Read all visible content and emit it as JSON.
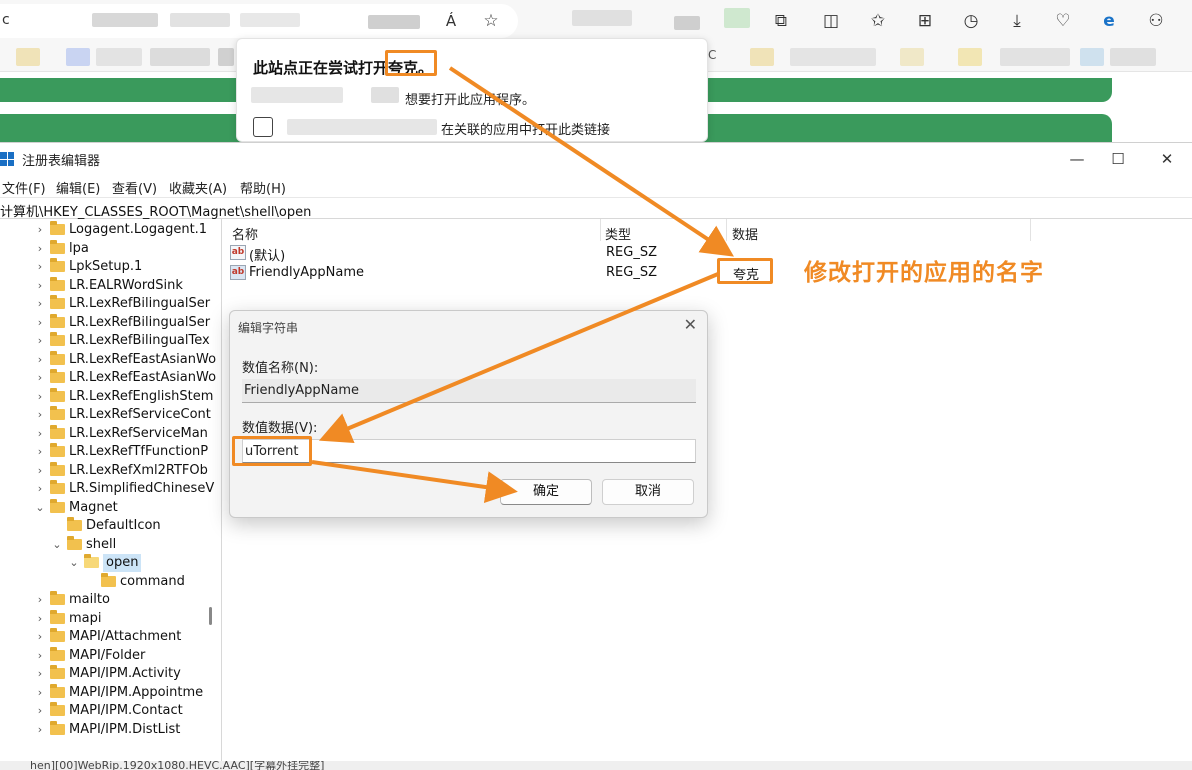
{
  "browser": {
    "address_prefix": "c",
    "reader_icon": "Á",
    "toolbar_icons": [
      "puzzle-icon",
      "split-screen-icon",
      "favorites-icon",
      "collections-icon",
      "history-icon",
      "download-icon",
      "heart-pulse-icon",
      "edge-icon",
      "profile-icon"
    ],
    "tab_fragment": "C"
  },
  "protocol_popup": {
    "title_prefix": "此站点正在尝试打开",
    "app_name": "夸克。",
    "open_line": "想要打开此应用程序。",
    "checkbox_label": "在关联的应用中打开此类链接"
  },
  "regedit": {
    "title": "注册表编辑器",
    "menu": [
      "文件(F)",
      "编辑(E)",
      "查看(V)",
      "收藏夹(A)",
      "帮助(H)"
    ],
    "path": "计算机\\HKEY_CLASSES_ROOT\\Magnet\\shell\\open",
    "tree": [
      {
        "label": "Logagent.Logagent.1",
        "indent": 0,
        "chev": "›"
      },
      {
        "label": "lpa",
        "indent": 0,
        "chev": "›"
      },
      {
        "label": "LpkSetup.1",
        "indent": 0,
        "chev": "›"
      },
      {
        "label": "LR.EALRWordSink",
        "indent": 0,
        "chev": "›"
      },
      {
        "label": "LR.LexRefBilingualSer",
        "indent": 0,
        "chev": "›"
      },
      {
        "label": "LR.LexRefBilingualSer",
        "indent": 0,
        "chev": "›"
      },
      {
        "label": "LR.LexRefBilingualTex",
        "indent": 0,
        "chev": "›"
      },
      {
        "label": "LR.LexRefEastAsianWo",
        "indent": 0,
        "chev": "›"
      },
      {
        "label": "LR.LexRefEastAsianWo",
        "indent": 0,
        "chev": "›"
      },
      {
        "label": "LR.LexRefEnglishStem",
        "indent": 0,
        "chev": "›"
      },
      {
        "label": "LR.LexRefServiceCont",
        "indent": 0,
        "chev": "›"
      },
      {
        "label": "LR.LexRefServiceMan",
        "indent": 0,
        "chev": "›"
      },
      {
        "label": "LR.LexRefTfFunctionP",
        "indent": 0,
        "chev": "›"
      },
      {
        "label": "LR.LexRefXml2RTFOb",
        "indent": 0,
        "chev": "›"
      },
      {
        "label": "LR.SimplifiedChineseV",
        "indent": 0,
        "chev": "›"
      },
      {
        "label": "Magnet",
        "indent": 0,
        "chev": "⌄"
      },
      {
        "label": "DefaultIcon",
        "indent": 1,
        "chev": ""
      },
      {
        "label": "shell",
        "indent": 1,
        "chev": "⌄"
      },
      {
        "label": "open",
        "indent": 2,
        "chev": "⌄",
        "selected": true
      },
      {
        "label": "command",
        "indent": 3,
        "chev": ""
      },
      {
        "label": "mailto",
        "indent": 0,
        "chev": "›"
      },
      {
        "label": "mapi",
        "indent": 0,
        "chev": "›"
      },
      {
        "label": "MAPI/Attachment",
        "indent": 0,
        "chev": "›"
      },
      {
        "label": "MAPI/Folder",
        "indent": 0,
        "chev": "›"
      },
      {
        "label": "MAPI/IPM.Activity",
        "indent": 0,
        "chev": "›"
      },
      {
        "label": "MAPI/IPM.Appointme",
        "indent": 0,
        "chev": "›"
      },
      {
        "label": "MAPI/IPM.Contact",
        "indent": 0,
        "chev": "›"
      },
      {
        "label": "MAPI/IPM.DistList",
        "indent": 0,
        "chev": "›"
      }
    ],
    "columns": {
      "name": "名称",
      "type": "类型",
      "data": "数据"
    },
    "values": [
      {
        "name": "(默认)",
        "type": "REG_SZ",
        "data": ""
      },
      {
        "name": "FriendlyAppName",
        "type": "REG_SZ",
        "data": "夸克"
      }
    ],
    "status": "hen][00]WebRip.1920x1080.HEVC.AAC][字幕外挂完整]"
  },
  "edit_dialog": {
    "title": "编辑字符串",
    "value_name_label": "数值名称(N):",
    "value_name": "FriendlyAppName",
    "value_data_label": "数值数据(V):",
    "value_data": "uTorrent",
    "ok_label": "确定",
    "cancel_label": "取消"
  },
  "annotation": {
    "text": "修改打开的应用的名字",
    "color": "#f08a24"
  }
}
